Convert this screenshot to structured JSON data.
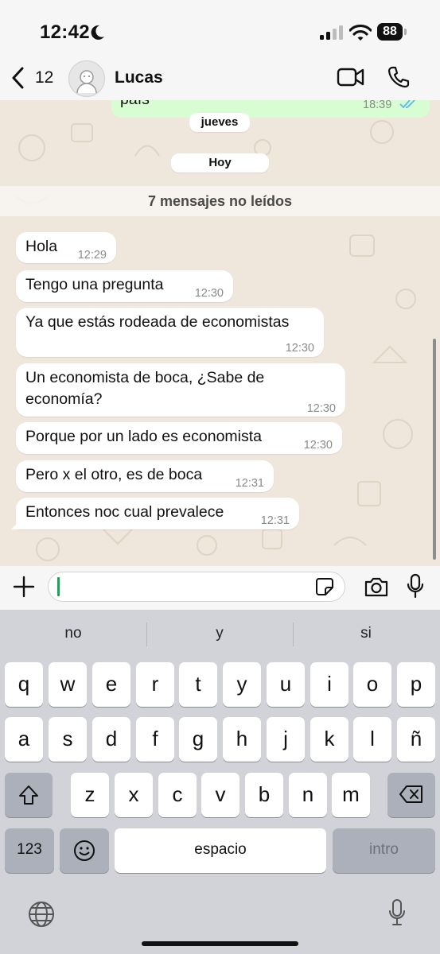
{
  "status_bar": {
    "time": "12:42",
    "battery": "88"
  },
  "header": {
    "back_count": "12",
    "contact_name": "Lucas"
  },
  "chat": {
    "sent_snippet": {
      "text": "país",
      "time": "18:39"
    },
    "date_chip_1": "jueves",
    "date_chip_2": "Hoy",
    "unread_banner": "7 mensajes no leídos",
    "messages": [
      {
        "text": "Hola",
        "time": "12:29"
      },
      {
        "text": "Tengo una pregunta",
        "time": "12:30"
      },
      {
        "text": "Ya que estás rodeada de economistas",
        "time": "12:30"
      },
      {
        "text": "Un economista de boca, ¿Sabe de economía?",
        "time": "12:30"
      },
      {
        "text": "Porque por un lado es economista",
        "time": "12:30"
      },
      {
        "text": "Pero x el otro, es de boca",
        "time": "12:31"
      },
      {
        "text": "Entonces noc cual prevalece",
        "time": "12:31"
      }
    ]
  },
  "input": {
    "value": ""
  },
  "keyboard": {
    "suggestions": [
      "no",
      "y",
      "si"
    ],
    "row1": [
      "q",
      "w",
      "e",
      "r",
      "t",
      "y",
      "u",
      "i",
      "o",
      "p"
    ],
    "row2": [
      "a",
      "s",
      "d",
      "f",
      "g",
      "h",
      "j",
      "k",
      "l",
      "ñ"
    ],
    "row3": [
      "z",
      "x",
      "c",
      "v",
      "b",
      "n",
      "m"
    ],
    "numbers_key": "123",
    "space_key": "espacio",
    "return_key": "intro"
  },
  "colors": {
    "sent_bubble": "#d9fdd3",
    "read_ticks": "#53bdeb",
    "cursor": "#1aa35a"
  }
}
